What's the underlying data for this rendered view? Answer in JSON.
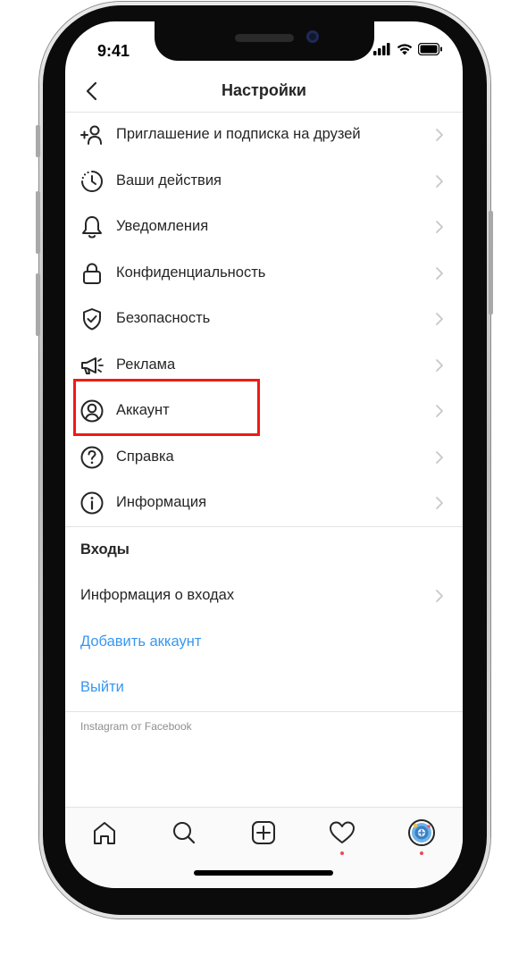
{
  "status_bar": {
    "time": "9:41"
  },
  "header": {
    "title": "Настройки"
  },
  "menu_items": [
    {
      "label": "Приглашение и подписка на друзей",
      "icon": "add-person-icon"
    },
    {
      "label": "Ваши действия",
      "icon": "activity-clock-icon"
    },
    {
      "label": "Уведомления",
      "icon": "bell-icon"
    },
    {
      "label": "Конфиденциальность",
      "icon": "lock-icon"
    },
    {
      "label": "Безопасность",
      "icon": "shield-check-icon"
    },
    {
      "label": "Реклама",
      "icon": "megaphone-icon"
    },
    {
      "label": "Аккаунт",
      "icon": "account-circle-icon"
    },
    {
      "label": "Справка",
      "icon": "help-question-icon"
    },
    {
      "label": "Информация",
      "icon": "info-icon"
    }
  ],
  "logins_section": {
    "title": "Входы",
    "login_info": "Информация о входах",
    "add_account": "Добавить аккаунт",
    "logout": "Выйти"
  },
  "footer": {
    "note": "Instagram от Facebook"
  },
  "colors": {
    "link": "#3897f0",
    "highlight": "#ee1c14",
    "notification_dot": "#ed4956"
  },
  "tabbar": {
    "tabs": [
      "home-icon",
      "search-icon",
      "add-post-icon",
      "heart-icon",
      "profile-avatar-icon"
    ]
  }
}
